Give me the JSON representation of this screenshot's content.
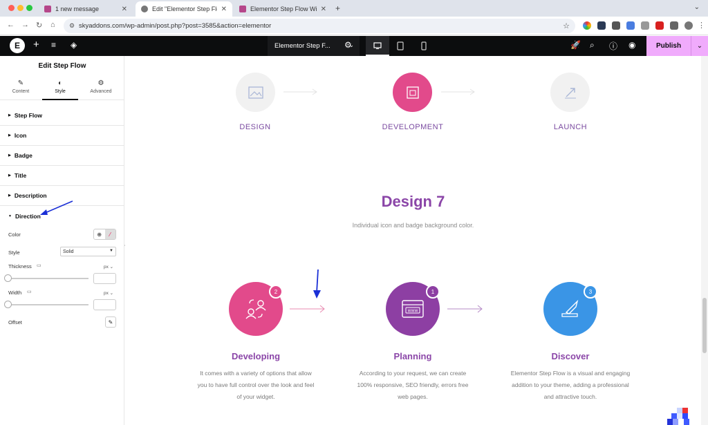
{
  "browser": {
    "tabs": [
      {
        "label": "1 new message"
      },
      {
        "label": "Edit \"Elementor Step Flow W"
      },
      {
        "label": "Elementor Step Flow Widget"
      }
    ],
    "url": "skyaddons.com/wp-admin/post.php?post=3585&action=elementor"
  },
  "editor": {
    "doc_title": "Elementor Step F...",
    "publish_label": "Publish"
  },
  "panel": {
    "title": "Edit Step Flow",
    "tabs": [
      {
        "label": "Content"
      },
      {
        "label": "Style"
      },
      {
        "label": "Advanced"
      }
    ],
    "sections": [
      {
        "label": "Step Flow"
      },
      {
        "label": "Icon"
      },
      {
        "label": "Badge"
      },
      {
        "label": "Title"
      },
      {
        "label": "Description"
      },
      {
        "label": "Direction"
      }
    ],
    "direction": {
      "color_label": "Color",
      "style_label": "Style",
      "style_value": "Solid",
      "thickness_label": "Thickness",
      "thickness_unit": "px",
      "width_label": "Width",
      "width_unit": "px",
      "offset_label": "Offset"
    }
  },
  "canvas": {
    "top_steps": [
      {
        "label": "DESIGN"
      },
      {
        "label": "DEVELOPMENT"
      },
      {
        "label": "LAUNCH"
      }
    ],
    "design7": {
      "title": "Design 7",
      "subtitle": "Individual icon and badge background color.",
      "steps": [
        {
          "title": "Developing",
          "badge": "2",
          "color": "#e24a8b",
          "desc": [
            "It comes with a variety of options that allow",
            "you to have full control over the look and feel",
            "of your widget."
          ]
        },
        {
          "title": "Planning",
          "badge": "1",
          "color": "#8d3fa3",
          "desc": [
            "According to your request, we can create",
            "100% responsive, SEO friendly, errors free",
            "web pages."
          ]
        },
        {
          "title": "Discover",
          "badge": "3",
          "color": "#3a95e6",
          "desc": [
            "Elementor Step Flow is a visual and engaging",
            "addition to your theme, adding a professional",
            "and attractive touch."
          ]
        }
      ]
    }
  },
  "colors": {
    "accent_purple": "#8b46a8",
    "publish_bg": "#f0abfc",
    "editor_bar": "#0c0d0e",
    "annotation_arrow": "#1a2fd6"
  }
}
